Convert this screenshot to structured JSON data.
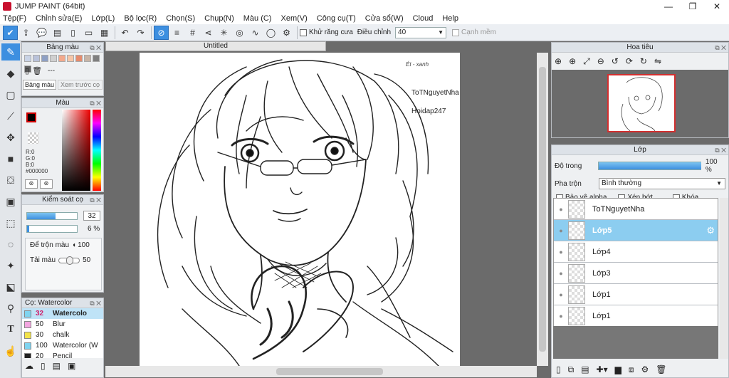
{
  "window": {
    "title": "JUMP PAINT (64bit)",
    "min": "—",
    "max": "❐",
    "close": "✕"
  },
  "menu": [
    "Tệp(F)",
    "Chỉnh sửa(E)",
    "Lớp(L)",
    "Bộ lọc(R)",
    "Chọn(S)",
    "Chụp(N)",
    "Màu (C)",
    "Xem(V)",
    "Công cụ(T)",
    "Cửa sổ(W)",
    "Cloud",
    "Help"
  ],
  "toolbar": {
    "antialias_label": "Khử răng cưa",
    "adjust_label": "Điều chỉnh",
    "adjust_value": "40",
    "edge_label": "Cạnh mềm"
  },
  "palette_panel": {
    "title": "Bảng màu",
    "value": "---",
    "tab1": "Bảng màu",
    "tab2": "Xem trước cọ",
    "swatches": [
      "#c9d3e6",
      "#b9c2da",
      "#8ea0c4",
      "#d0d0d0",
      "#f3a98c",
      "#f6c6a8",
      "#e58b6d",
      "#c7b4a6",
      "#7f7f7f",
      "#5e5e5e"
    ]
  },
  "color_panel": {
    "title": "Màu",
    "r": "R:0",
    "g": "G:0",
    "b": "B:0",
    "hex": "#000000"
  },
  "brush_control": {
    "title": "Kiểm soát cọ",
    "size": "32",
    "opacity": "6 %",
    "blend_label": "Để trộn màu",
    "blend_value": "100",
    "color_label": "Tải màu",
    "color_value": "50"
  },
  "brush_list": {
    "title": "Cọ: Watercolor",
    "items": [
      {
        "size": "32",
        "name": "Watercolo",
        "color": "#7fd4f0",
        "selected": true
      },
      {
        "size": "50",
        "name": "Blur",
        "color": "#f3a6e0",
        "selected": false
      },
      {
        "size": "30",
        "name": "chalk",
        "color": "#f2e34a",
        "selected": false
      },
      {
        "size": "100",
        "name": "Watercolor (W",
        "color": "#7fd4f0",
        "selected": false
      },
      {
        "size": "20",
        "name": "Pencil",
        "color": "#222222",
        "selected": false
      }
    ]
  },
  "document": {
    "tab_title": "Untitled",
    "text1": "ToTNguyetNha",
    "text2": "Hoidap247",
    "sig": "Ét - xanh"
  },
  "navigator": {
    "title": "Hoa tiêu"
  },
  "layers_panel": {
    "title": "Lớp",
    "opacity_label": "Độ trong",
    "opacity_value": "100 %",
    "opacity_fraction": 1.0,
    "blend_label": "Pha trộn",
    "blend_value": "Bình thường",
    "protect_alpha": "Bảo vệ alpha",
    "clipping": "Xén bớt",
    "lock": "Khóa",
    "layers": [
      {
        "name": "ToTNguyetNha",
        "selected": false
      },
      {
        "name": "Lớp5",
        "selected": true
      },
      {
        "name": "Lớp4",
        "selected": false
      },
      {
        "name": "Lớp3",
        "selected": false
      },
      {
        "name": "Lớp1",
        "selected": false
      },
      {
        "name": "Lớp1",
        "selected": false
      }
    ]
  },
  "colors": {
    "accent": "#3d8fe0",
    "selected_layer": "#8ccdf0",
    "nav_frame": "#d32f2f"
  }
}
